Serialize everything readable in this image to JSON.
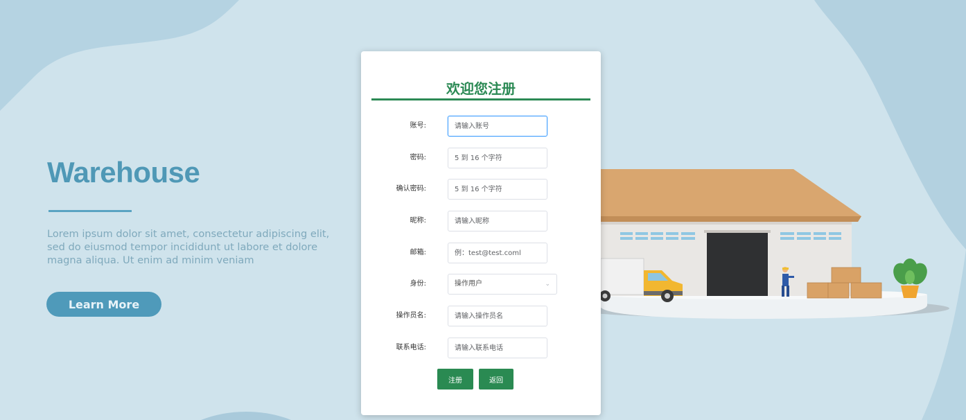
{
  "hero": {
    "title": "Warehouse",
    "text": "Lorem ipsum dolor sit amet, consectetur adipiscing elit, sed do eiusmod tempor incididunt ut labore et dolore magna aliqua. Ut enim ad minim veniam",
    "button_label": "Learn More"
  },
  "form": {
    "title": "欢迎您注册",
    "fields": [
      {
        "label": "账号:",
        "placeholder": "请输入账号"
      },
      {
        "label": "密码:",
        "placeholder": "5 到 16 个字符"
      },
      {
        "label": "确认密码:",
        "placeholder": "5 到 16 个字符"
      },
      {
        "label": "昵称:",
        "placeholder": "请输入昵称"
      },
      {
        "label": "邮箱:",
        "placeholder": "例：test@test.coml"
      },
      {
        "label": "身份:",
        "value": "操作用户"
      },
      {
        "label": "操作员名:",
        "placeholder": "请输入操作员名"
      },
      {
        "label": "联系电话:",
        "placeholder": "请输入联系电话"
      }
    ],
    "register_label": "注册",
    "back_label": "返回"
  },
  "colors": {
    "background": "#cfe3ec",
    "accent_green": "#2a8a52",
    "hero_blue": "#4f9aba"
  },
  "icons": {
    "select_arrow": "chevron-down-icon"
  }
}
